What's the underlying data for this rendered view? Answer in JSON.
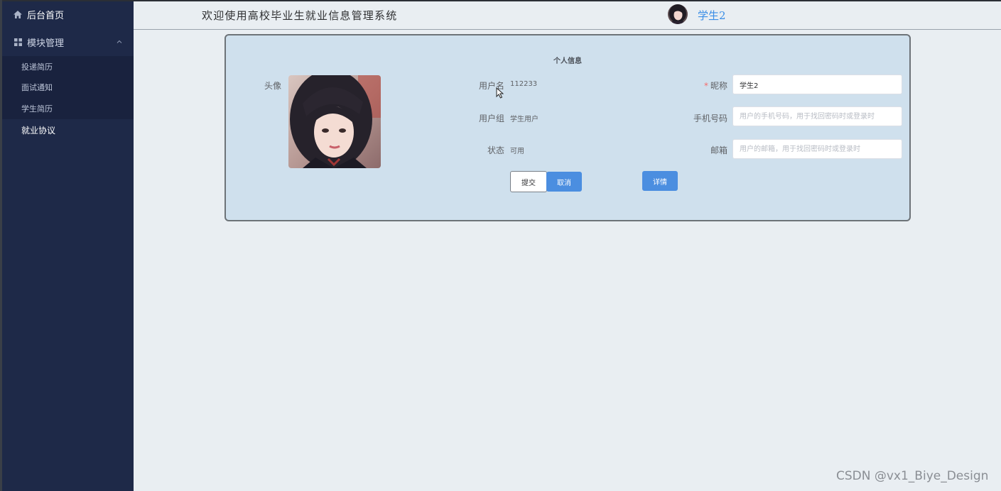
{
  "sidebar": {
    "home_label": "后台首页",
    "group_label": "模块管理",
    "items": [
      {
        "label": "投递简历"
      },
      {
        "label": "面试通知"
      },
      {
        "label": "学生简历"
      },
      {
        "label": "就业协议"
      }
    ]
  },
  "header": {
    "title": "欢迎使用高校毕业生就业信息管理系统",
    "username": "学生2"
  },
  "profile": {
    "card_title": "个人信息",
    "avatar_label": "头像",
    "username_label": "用户名",
    "username_value": "112233",
    "group_label": "用户组",
    "group_value": "学生用户",
    "status_label": "状态",
    "status_value": "可用",
    "nickname_required": "*",
    "nickname_label": "昵称",
    "nickname_value": "学生2",
    "phone_label": "手机号码",
    "phone_placeholder": "用户的手机号码，用于找回密码时或登录时",
    "email_label": "邮箱",
    "email_placeholder": "用户的邮箱，用于找回密码时或登录时",
    "submit_label": "提交",
    "cancel_label": "取消",
    "detail_label": "详情"
  },
  "watermark": "CSDN @vx1_Biye_Design",
  "colors": {
    "sidebar_bg": "#1e2948",
    "card_bg": "#cfe0ed",
    "accent": "#4b8ee0",
    "username": "#3a8ee6"
  }
}
